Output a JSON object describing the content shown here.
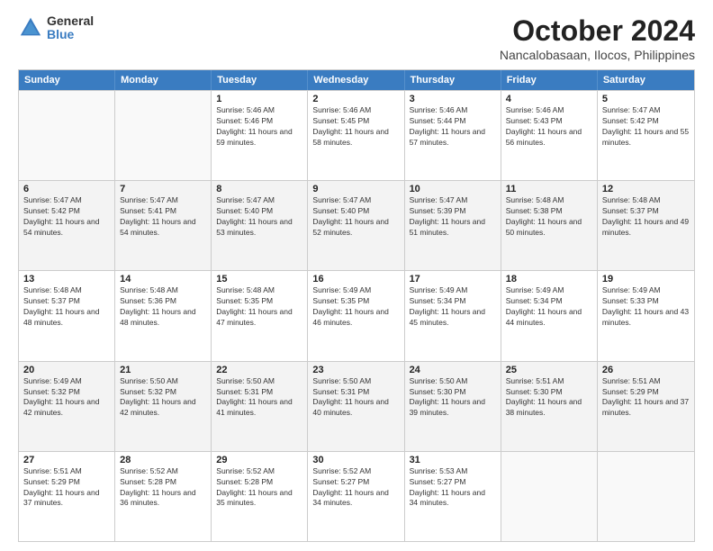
{
  "logo": {
    "general": "General",
    "blue": "Blue"
  },
  "header": {
    "month": "October 2024",
    "location": "Nancalobasaan, Ilocos, Philippines"
  },
  "weekdays": [
    "Sunday",
    "Monday",
    "Tuesday",
    "Wednesday",
    "Thursday",
    "Friday",
    "Saturday"
  ],
  "rows": [
    {
      "alt": false,
      "cells": [
        {
          "day": "",
          "info": ""
        },
        {
          "day": "",
          "info": ""
        },
        {
          "day": "1",
          "info": "Sunrise: 5:46 AM\nSunset: 5:46 PM\nDaylight: 11 hours and 59 minutes."
        },
        {
          "day": "2",
          "info": "Sunrise: 5:46 AM\nSunset: 5:45 PM\nDaylight: 11 hours and 58 minutes."
        },
        {
          "day": "3",
          "info": "Sunrise: 5:46 AM\nSunset: 5:44 PM\nDaylight: 11 hours and 57 minutes."
        },
        {
          "day": "4",
          "info": "Sunrise: 5:46 AM\nSunset: 5:43 PM\nDaylight: 11 hours and 56 minutes."
        },
        {
          "day": "5",
          "info": "Sunrise: 5:47 AM\nSunset: 5:42 PM\nDaylight: 11 hours and 55 minutes."
        }
      ]
    },
    {
      "alt": true,
      "cells": [
        {
          "day": "6",
          "info": "Sunrise: 5:47 AM\nSunset: 5:42 PM\nDaylight: 11 hours and 54 minutes."
        },
        {
          "day": "7",
          "info": "Sunrise: 5:47 AM\nSunset: 5:41 PM\nDaylight: 11 hours and 54 minutes."
        },
        {
          "day": "8",
          "info": "Sunrise: 5:47 AM\nSunset: 5:40 PM\nDaylight: 11 hours and 53 minutes."
        },
        {
          "day": "9",
          "info": "Sunrise: 5:47 AM\nSunset: 5:40 PM\nDaylight: 11 hours and 52 minutes."
        },
        {
          "day": "10",
          "info": "Sunrise: 5:47 AM\nSunset: 5:39 PM\nDaylight: 11 hours and 51 minutes."
        },
        {
          "day": "11",
          "info": "Sunrise: 5:48 AM\nSunset: 5:38 PM\nDaylight: 11 hours and 50 minutes."
        },
        {
          "day": "12",
          "info": "Sunrise: 5:48 AM\nSunset: 5:37 PM\nDaylight: 11 hours and 49 minutes."
        }
      ]
    },
    {
      "alt": false,
      "cells": [
        {
          "day": "13",
          "info": "Sunrise: 5:48 AM\nSunset: 5:37 PM\nDaylight: 11 hours and 48 minutes."
        },
        {
          "day": "14",
          "info": "Sunrise: 5:48 AM\nSunset: 5:36 PM\nDaylight: 11 hours and 48 minutes."
        },
        {
          "day": "15",
          "info": "Sunrise: 5:48 AM\nSunset: 5:35 PM\nDaylight: 11 hours and 47 minutes."
        },
        {
          "day": "16",
          "info": "Sunrise: 5:49 AM\nSunset: 5:35 PM\nDaylight: 11 hours and 46 minutes."
        },
        {
          "day": "17",
          "info": "Sunrise: 5:49 AM\nSunset: 5:34 PM\nDaylight: 11 hours and 45 minutes."
        },
        {
          "day": "18",
          "info": "Sunrise: 5:49 AM\nSunset: 5:34 PM\nDaylight: 11 hours and 44 minutes."
        },
        {
          "day": "19",
          "info": "Sunrise: 5:49 AM\nSunset: 5:33 PM\nDaylight: 11 hours and 43 minutes."
        }
      ]
    },
    {
      "alt": true,
      "cells": [
        {
          "day": "20",
          "info": "Sunrise: 5:49 AM\nSunset: 5:32 PM\nDaylight: 11 hours and 42 minutes."
        },
        {
          "day": "21",
          "info": "Sunrise: 5:50 AM\nSunset: 5:32 PM\nDaylight: 11 hours and 42 minutes."
        },
        {
          "day": "22",
          "info": "Sunrise: 5:50 AM\nSunset: 5:31 PM\nDaylight: 11 hours and 41 minutes."
        },
        {
          "day": "23",
          "info": "Sunrise: 5:50 AM\nSunset: 5:31 PM\nDaylight: 11 hours and 40 minutes."
        },
        {
          "day": "24",
          "info": "Sunrise: 5:50 AM\nSunset: 5:30 PM\nDaylight: 11 hours and 39 minutes."
        },
        {
          "day": "25",
          "info": "Sunrise: 5:51 AM\nSunset: 5:30 PM\nDaylight: 11 hours and 38 minutes."
        },
        {
          "day": "26",
          "info": "Sunrise: 5:51 AM\nSunset: 5:29 PM\nDaylight: 11 hours and 37 minutes."
        }
      ]
    },
    {
      "alt": false,
      "cells": [
        {
          "day": "27",
          "info": "Sunrise: 5:51 AM\nSunset: 5:29 PM\nDaylight: 11 hours and 37 minutes."
        },
        {
          "day": "28",
          "info": "Sunrise: 5:52 AM\nSunset: 5:28 PM\nDaylight: 11 hours and 36 minutes."
        },
        {
          "day": "29",
          "info": "Sunrise: 5:52 AM\nSunset: 5:28 PM\nDaylight: 11 hours and 35 minutes."
        },
        {
          "day": "30",
          "info": "Sunrise: 5:52 AM\nSunset: 5:27 PM\nDaylight: 11 hours and 34 minutes."
        },
        {
          "day": "31",
          "info": "Sunrise: 5:53 AM\nSunset: 5:27 PM\nDaylight: 11 hours and 34 minutes."
        },
        {
          "day": "",
          "info": ""
        },
        {
          "day": "",
          "info": ""
        }
      ]
    }
  ]
}
